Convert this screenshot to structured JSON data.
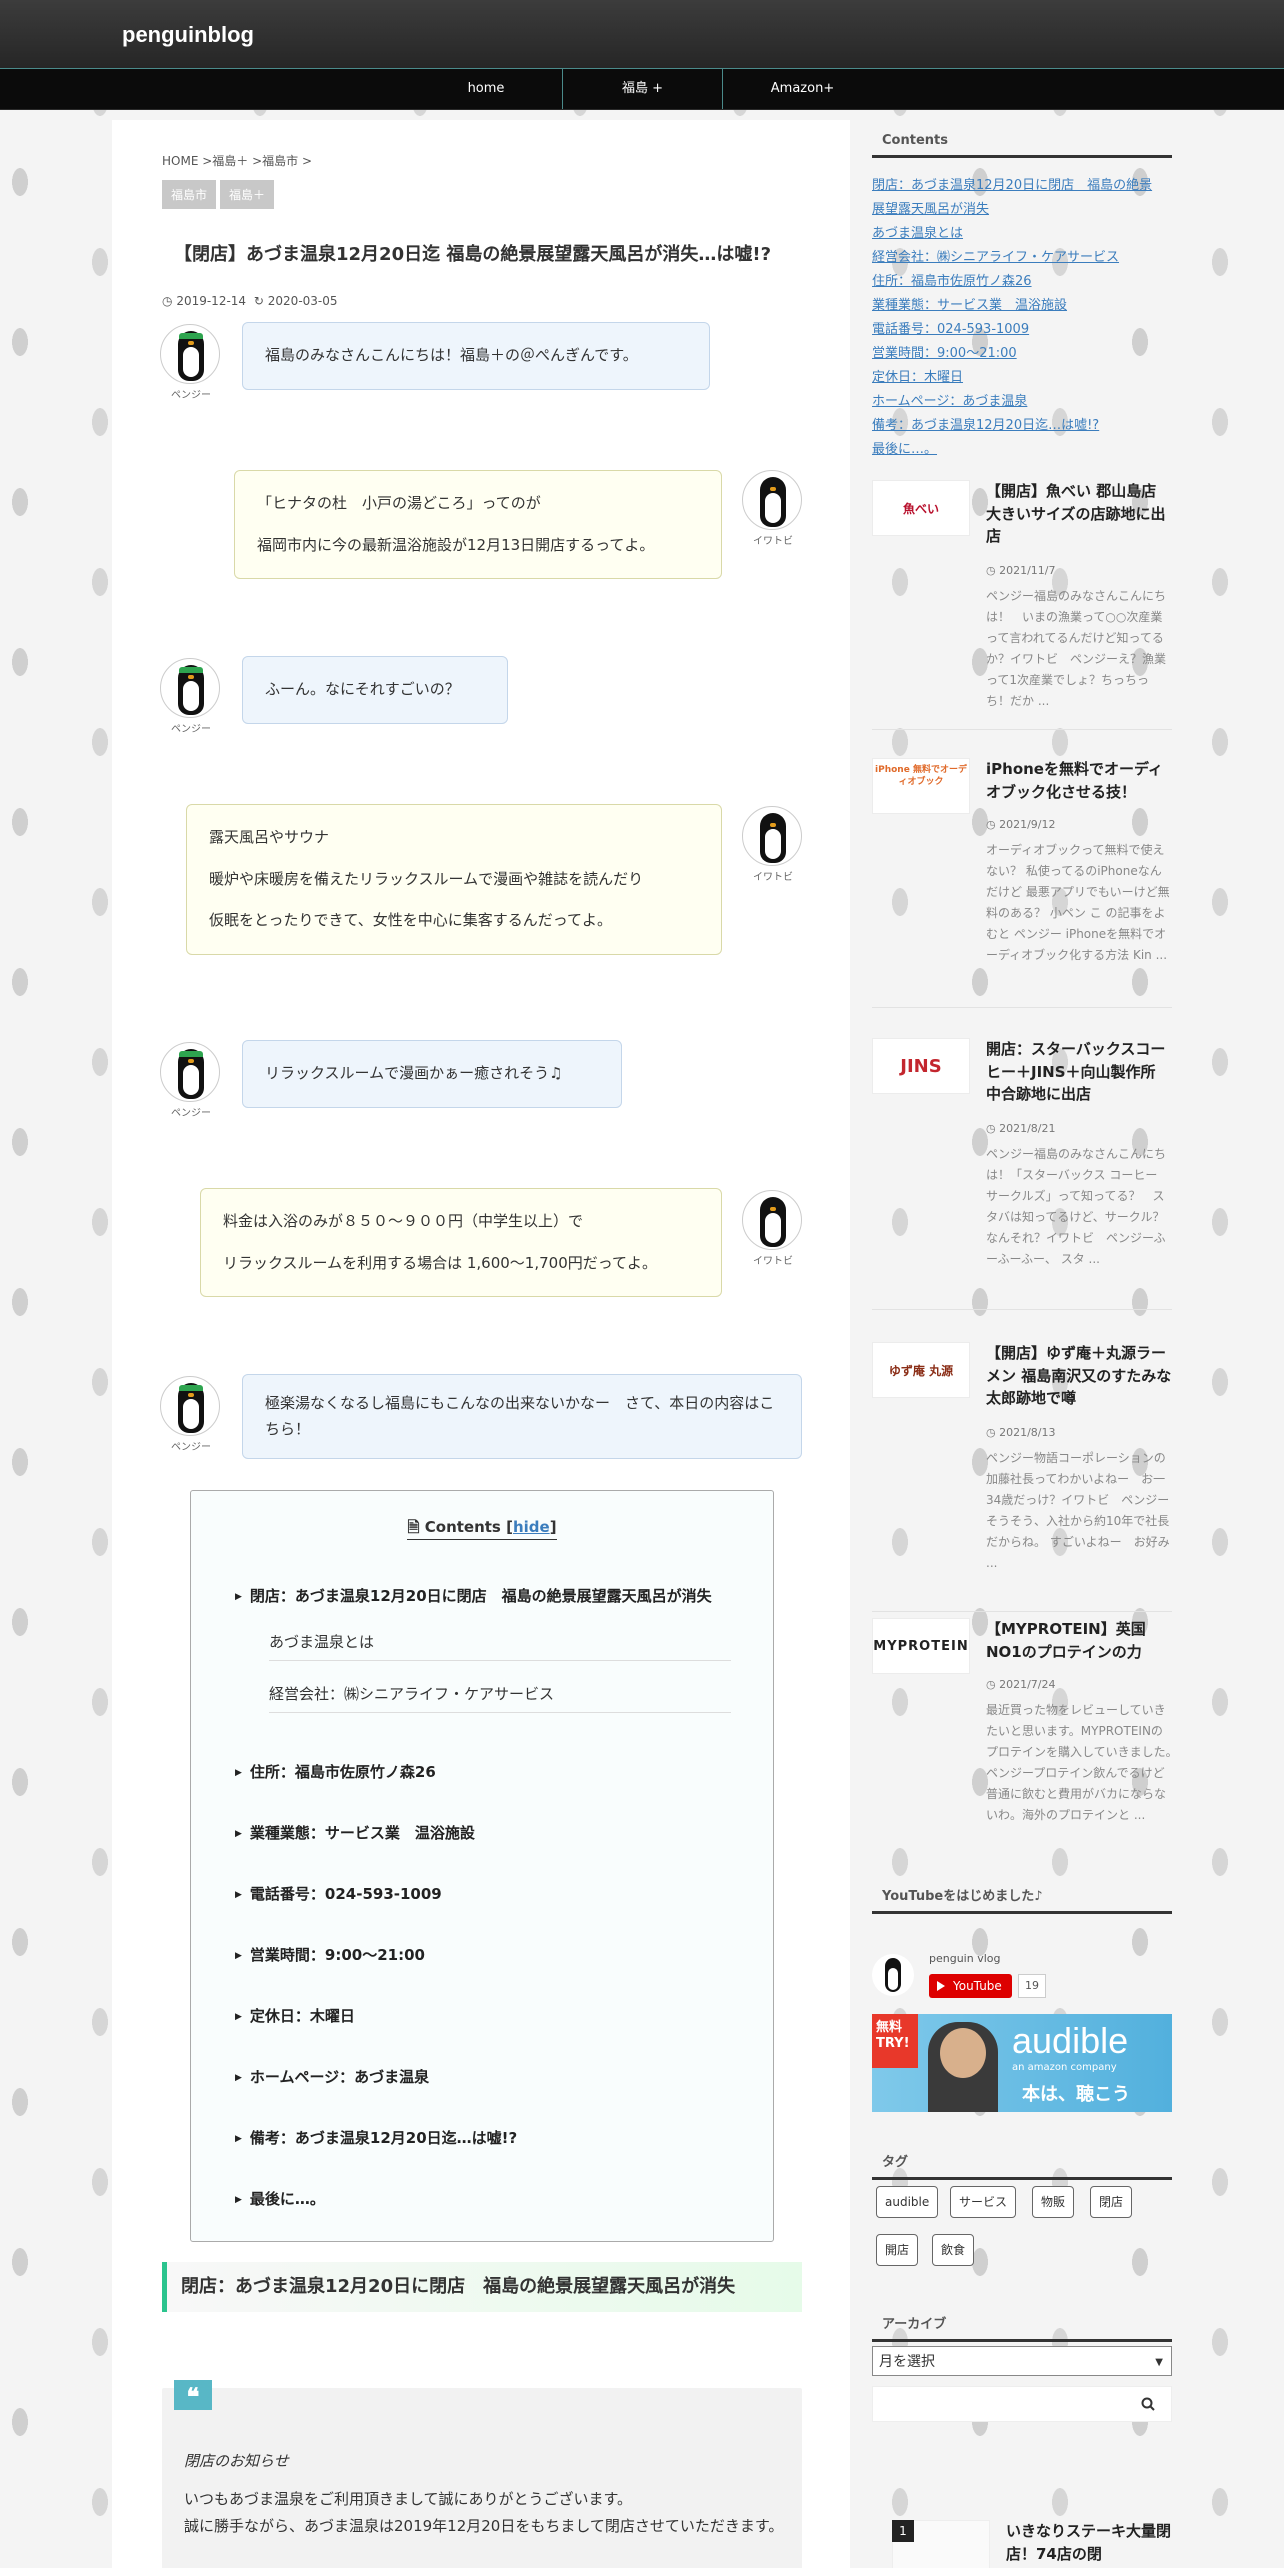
{
  "site": {
    "title": "penguinblog"
  },
  "nav": [
    {
      "label": "home"
    },
    {
      "label": "福島 +"
    },
    {
      "label": "Amazon+"
    }
  ],
  "breadcrumb": "HOME >福島＋ >福島市 >",
  "categories": [
    "福島市",
    "福島＋"
  ],
  "article": {
    "title": "【閉店】あづま温泉12月20日迄 福島の絶景展望露天風呂が消失…は嘘!?",
    "published": "2019-12-14",
    "updated": "2020-03-05"
  },
  "speakers": {
    "left": "ペンジー",
    "right": "イワトビ"
  },
  "dialogue": [
    {
      "side": "left",
      "lines": [
        "福島のみなさんこんにちは！福島＋の＠ぺんぎんです。"
      ]
    },
    {
      "side": "right",
      "lines": [
        "「ヒナタの杜　小戸の湯どころ」ってのが",
        "福岡市内に今の最新温浴施設が12月13日開店するってよ。"
      ]
    },
    {
      "side": "left",
      "lines": [
        "ふーん。なにそれすごいの？"
      ]
    },
    {
      "side": "right",
      "lines": [
        "露天風呂やサウナ",
        "暖炉や床暖房を備えたリラックスルームで漫画や雑誌を読んだり",
        "仮眠をとったりできて、女性を中心に集客するんだってよ。"
      ]
    },
    {
      "side": "left",
      "lines": [
        "リラックスルームで漫画かぁー癒されそう♫"
      ]
    },
    {
      "side": "right",
      "lines": [
        "料金は入浴のみが８５０～９００円（中学生以上）で",
        "リラックスルームを利用する場合は 1,600～1,700円だってよ。"
      ]
    },
    {
      "side": "left",
      "lines": [
        "極楽湯なくなるし福島にもこんなの出来ないかなー　さて、本日の内容はこちら！"
      ]
    }
  ],
  "toc": {
    "title": "Contents",
    "hide_label": "hide",
    "items": [
      "閉店：あづま温泉12月20日に閉店　福島の絶景展望露天風呂が消失",
      "住所：福島市佐原竹ノ森26",
      "業種業態：サービス業　温浴施設",
      "電話番号：024-593-1009",
      "営業時間：9:00～21:00",
      "定休日：木曜日",
      "ホームページ：あづま温泉",
      "備考：あづま温泉12月20日迄…は嘘!?",
      "最後に…。"
    ],
    "subitems": [
      "あづま温泉とは",
      "経営会社：㈱シニアライフ・ケアサービス"
    ]
  },
  "section_heading": "閉店：あづま温泉12月20日に閉店　福島の絶景展望露天風呂が消失",
  "quote": {
    "mark": "❝",
    "title": "閉店のお知らせ",
    "lines": [
      "いつもあづま温泉をご利用頂きまして誠にありがとうございます。",
      "誠に勝手ながら、あづま温泉は2019年12月20日をもちまして閉店させていただきます。"
    ]
  },
  "sidebar": {
    "toc_widget": {
      "title": "Contents",
      "links": [
        "閉店：あづま温泉12月20日に閉店　福島の絶景",
        "展望露天風呂が消失",
        "あづま温泉とは",
        "経営会社：㈱シニアライフ・ケアサービス",
        "住所：福島市佐原竹ノ森26",
        "業種業態：サービス業　温浴施設",
        "電話番号：024-593-1009",
        "営業時間：9:00～21:00",
        "定休日：木曜日",
        "ホームページ：あづま温泉",
        "備考：あづま温泉12月20日迄…は嘘!?",
        "最後に…。"
      ]
    },
    "posts": [
      {
        "thumb": "魚べい",
        "title": "【開店】魚べい 郡山島店 大きいサイズの店跡地に出店",
        "date": "2021/11/7",
        "excerpt": "ペンジー福島のみなさんこんにちは！　いまの漁業って○○次産業って言われてるんだけど知ってるか？イワトビ　ペンジーえ？漁業って1次産業でしょ？ちっちっち！だか ..."
      },
      {
        "thumb": "iPhone 無料でオーディオブック",
        "title": "iPhoneを無料でオーディオブック化させる技！",
        "date": "2021/9/12",
        "excerpt": "オーディオブックって無料で使えない？ 私使ってるのiPhoneなんだけど 最悪アプリでもいーけど無料のある？ 小ペン こ の記事をよむと ペンジー iPhoneを無料でオーディオブック化する方法 Kin ..."
      },
      {
        "thumb": "JINS",
        "title": "開店：スターバックスコーヒー＋JINS＋向山製作所　中合跡地に出店",
        "date": "2021/8/21",
        "excerpt": "ペンジー福島のみなさんこんにちは！「スターバックス コーヒー サークルズ」って知ってる？　スタバは知ってるけど、サークル？なんそれ？イワトビ　ペンジーふーふーふー、 スタ ..."
      },
      {
        "thumb": "ゆず庵 丸源",
        "title": "【開店】ゆず庵＋丸源ラーメン 福島南沢又のすたみな太郎跡地で噂",
        "date": "2021/8/13",
        "excerpt": "ペンジー物語コーポレーションの加藤社長ってわかいよねー　お一34歳だっけ？イワトビ　ペンジーそうそう、入社から約10年で社長だからね。 すごいよねー　お好み ..."
      },
      {
        "thumb": "MYPROTEIN",
        "title": "【MYPROTEIN】英国NO1のプロテインの力",
        "date": "2021/7/24",
        "excerpt": "最近買った物をレビューしていきたいと思います。MYPROTEINのプロテインを購入していきました。　ペンジープロテイン飲んでるけど普通に飲むと費用がバカにならないわ。海外のプロテインと ..."
      }
    ],
    "youtube": {
      "title": "YouTubeをはじめました♪",
      "channel": "penguin vlog",
      "button": "YouTube",
      "count": "19"
    },
    "ad": {
      "free": "無料 TRY!",
      "brand": "audible",
      "sub": "an amazon company",
      "copy": "本は、聴こう"
    },
    "tag_widget": {
      "title": "タグ",
      "tags": [
        "audible",
        "サービス",
        "物販",
        "閉店",
        "開店",
        "飲食"
      ]
    },
    "archive": {
      "title": "アーカイブ",
      "select": "月を選択"
    },
    "ranking": {
      "num": "1",
      "title": "いきなりステーキ大量閉店！74店の閉"
    }
  },
  "colors": {
    "accent": "#2bc48e",
    "link": "#3b7dbd",
    "header": "#262626",
    "nav": "#0b0b0b",
    "balloon_left": "#eef5fc",
    "balloon_right": "#fffff2"
  }
}
